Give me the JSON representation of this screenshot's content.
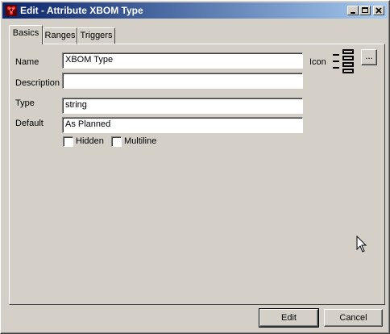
{
  "window": {
    "title": "Edit - Attribute XBOM Type"
  },
  "tabs": [
    {
      "label": "Basics",
      "active": true
    },
    {
      "label": "Ranges",
      "active": false
    },
    {
      "label": "Triggers",
      "active": false
    }
  ],
  "form": {
    "name_label": "Name",
    "name_value": "XBOM Type",
    "description_label": "Description",
    "description_value": "",
    "type_label": "Type",
    "type_value": "string",
    "default_label": "Default",
    "default_value": "As Planned",
    "hidden_label": "Hidden",
    "hidden_checked": false,
    "multiline_label": "Multiline",
    "multiline_checked": false,
    "icon_label": "Icon",
    "icon_browse_label": "..."
  },
  "buttons": {
    "edit": "Edit",
    "cancel": "Cancel"
  }
}
